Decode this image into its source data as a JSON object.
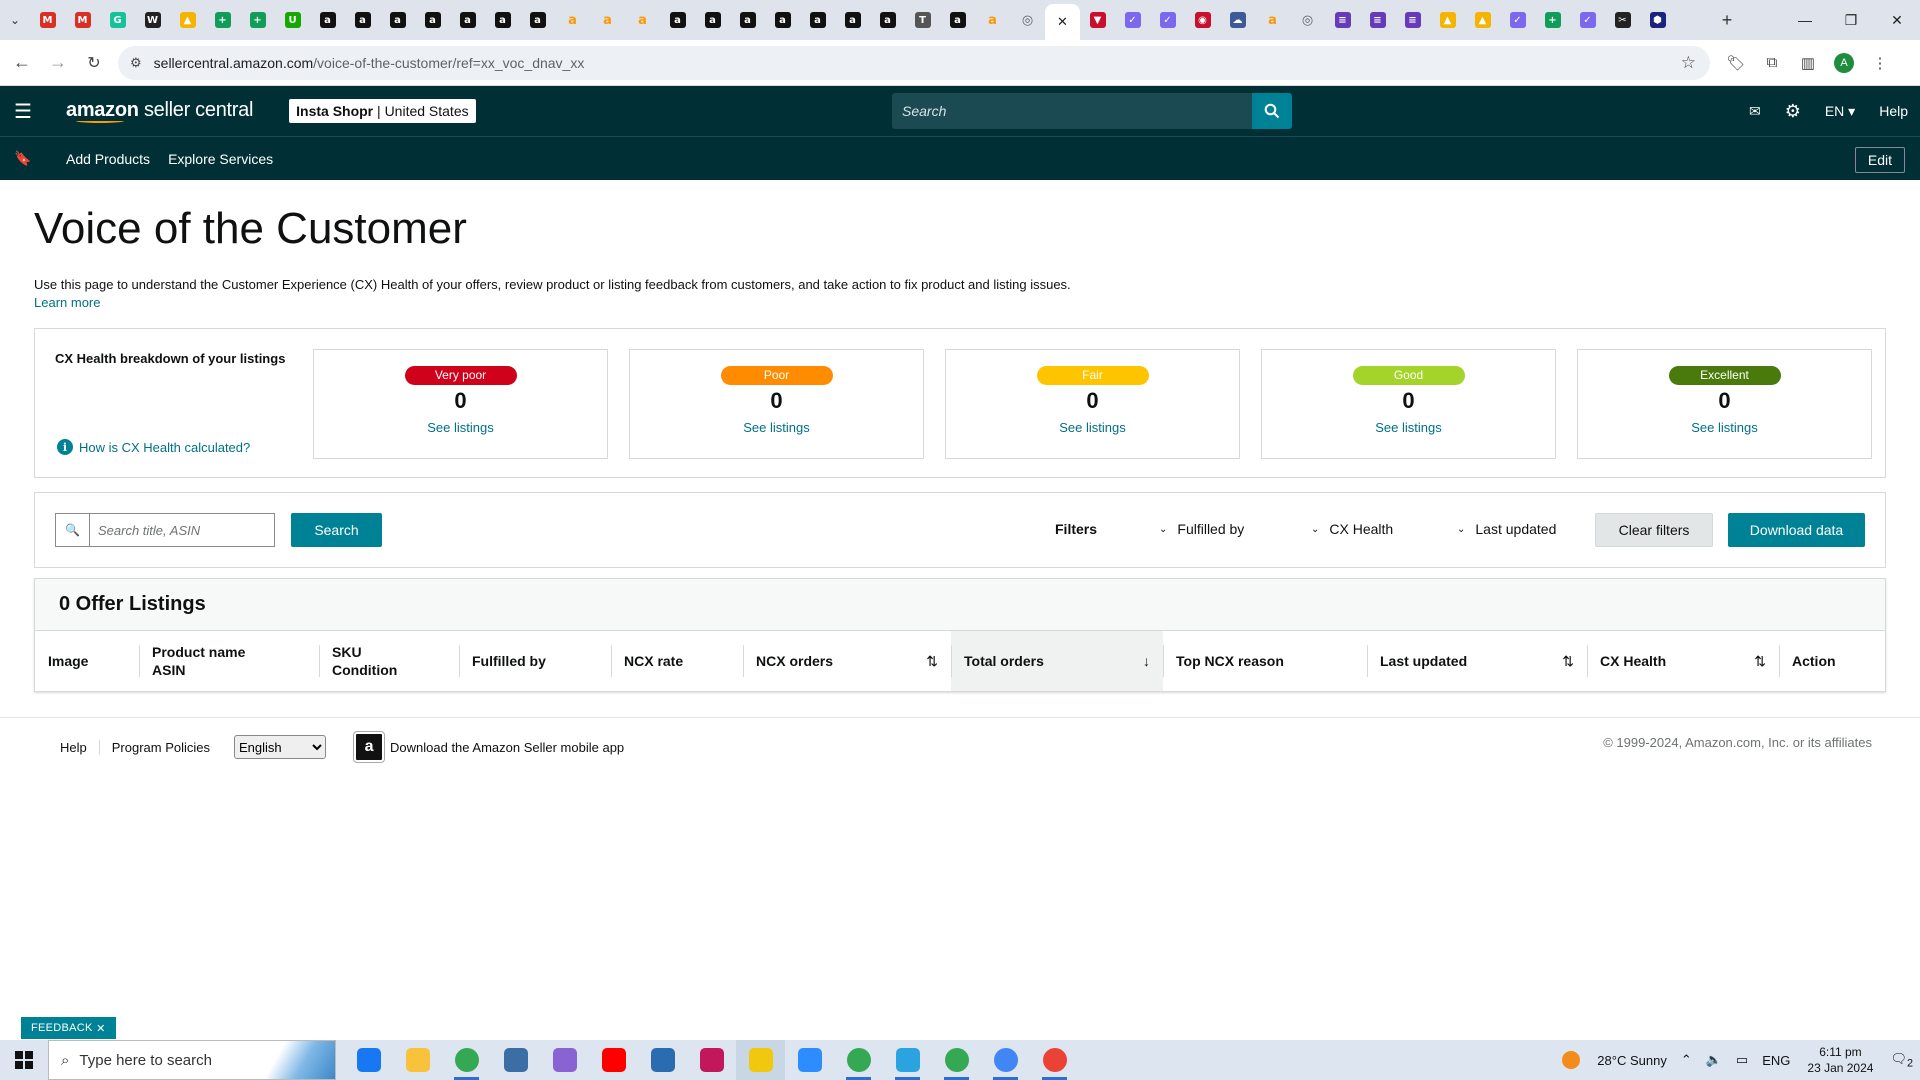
{
  "browser": {
    "url_host": "sellercentral.amazon.com",
    "url_path": "/voice-of-the-customer/ref=xx_voc_dnav_xx",
    "tab_favicons": [
      {
        "icon": "gmail-icon",
        "color": "#d93025",
        "glyph": "M"
      },
      {
        "icon": "gmail-icon",
        "color": "#d93025",
        "glyph": "M"
      },
      {
        "icon": "grammarly-icon",
        "color": "#15c39a",
        "glyph": "G"
      },
      {
        "icon": "wix-icon",
        "color": "#222222",
        "glyph": "W"
      },
      {
        "icon": "drive-icon",
        "color": "#f4b400",
        "glyph": "▲"
      },
      {
        "icon": "sheets-icon",
        "color": "#0f9d58",
        "glyph": "+"
      },
      {
        "icon": "sheets-icon",
        "color": "#0f9d58",
        "glyph": "+"
      },
      {
        "icon": "upwork-icon",
        "color": "#14a800",
        "glyph": "U"
      },
      {
        "icon": "amazon-icon",
        "color": "#111111",
        "glyph": "a"
      },
      {
        "icon": "amazon-icon",
        "color": "#111111",
        "glyph": "a"
      },
      {
        "icon": "amazon-icon",
        "color": "#111111",
        "glyph": "a"
      },
      {
        "icon": "amazon-icon",
        "color": "#111111",
        "glyph": "a"
      },
      {
        "icon": "amazon-icon",
        "color": "#111111",
        "glyph": "a"
      },
      {
        "icon": "amazon-icon",
        "color": "#111111",
        "glyph": "a"
      },
      {
        "icon": "amazon-icon",
        "color": "#111111",
        "glyph": "a"
      },
      {
        "icon": "amazon-smile-icon",
        "color": "#ff9900",
        "glyph": "a"
      },
      {
        "icon": "amazon-smile-icon",
        "color": "#ff9900",
        "glyph": "a"
      },
      {
        "icon": "amazon-smile-icon",
        "color": "#ff9900",
        "glyph": "a"
      },
      {
        "icon": "amazon-icon",
        "color": "#111111",
        "glyph": "a"
      },
      {
        "icon": "amazon-icon",
        "color": "#111111",
        "glyph": "a"
      },
      {
        "icon": "amazon-icon",
        "color": "#111111",
        "glyph": "a"
      },
      {
        "icon": "amazon-icon",
        "color": "#111111",
        "glyph": "a"
      },
      {
        "icon": "amazon-icon",
        "color": "#111111",
        "glyph": "a"
      },
      {
        "icon": "amazon-icon",
        "color": "#111111",
        "glyph": "a"
      },
      {
        "icon": "amazon-icon",
        "color": "#111111",
        "glyph": "a"
      },
      {
        "icon": "helium-icon",
        "color": "#555555",
        "glyph": "T"
      },
      {
        "icon": "amazon-icon",
        "color": "#111111",
        "glyph": "a"
      },
      {
        "icon": "amazon-smile-icon",
        "color": "#ff9900",
        "glyph": "a"
      },
      {
        "icon": "globe-icon",
        "color": "#5f6368",
        "glyph": "◎"
      },
      {
        "icon": "close-icon",
        "color": "#202124",
        "glyph": "✕"
      },
      {
        "icon": "pin-icon",
        "color": "#c8102e",
        "glyph": "▼"
      },
      {
        "icon": "clickup-icon",
        "color": "#7b68ee",
        "glyph": "✓"
      },
      {
        "icon": "clickup-icon",
        "color": "#7b68ee",
        "glyph": "✓"
      },
      {
        "icon": "media-icon",
        "color": "#c8102e",
        "glyph": "◉"
      },
      {
        "icon": "cloud-icon",
        "color": "#3d5a99",
        "glyph": "☁"
      },
      {
        "icon": "amazon-smile-icon",
        "color": "#ff9900",
        "glyph": "a"
      },
      {
        "icon": "globe-icon",
        "color": "#5f6368",
        "glyph": "◎"
      },
      {
        "icon": "forms-icon",
        "color": "#673ab7",
        "glyph": "≡"
      },
      {
        "icon": "forms-icon",
        "color": "#673ab7",
        "glyph": "≡"
      },
      {
        "icon": "forms-icon",
        "color": "#673ab7",
        "glyph": "≡"
      },
      {
        "icon": "drive-icon",
        "color": "#f4b400",
        "glyph": "▲"
      },
      {
        "icon": "drive-icon",
        "color": "#f4b400",
        "glyph": "▲"
      },
      {
        "icon": "clickup-icon",
        "color": "#7b68ee",
        "glyph": "✓"
      },
      {
        "icon": "sheets-icon",
        "color": "#0f9d58",
        "glyph": "+"
      },
      {
        "icon": "clickup-icon",
        "color": "#7b68ee",
        "glyph": "✓"
      },
      {
        "icon": "scissor-icon",
        "color": "#222222",
        "glyph": "✂"
      },
      {
        "icon": "hexagon-icon",
        "color": "#1a237e",
        "glyph": "⬢"
      }
    ],
    "profile_initial": "A"
  },
  "header": {
    "logo_brand": "amazon",
    "logo_suffix": "seller central",
    "account_store": "Insta Shopr",
    "account_region": "United States",
    "search_placeholder": "Search",
    "language": "EN",
    "help": "Help"
  },
  "subnav": {
    "add_products": "Add Products",
    "explore_services": "Explore Services",
    "edit": "Edit"
  },
  "page": {
    "title": "Voice of the Customer",
    "description": "Use this page to understand the Customer Experience (CX) Health of your offers, review product or listing feedback from customers, and take action to fix product and listing issues.",
    "learn_more": "Learn more"
  },
  "cx_health": {
    "title": "CX Health breakdown of your listings",
    "how_link": "How is CX Health calculated?",
    "cards": [
      {
        "label": "Very poor",
        "count": "0",
        "link": "See listings",
        "color": "#d0021b",
        "text_color": "#ffffff"
      },
      {
        "label": "Poor",
        "count": "0",
        "link": "See listings",
        "color": "#ff8c00",
        "text_color": "#ffffff"
      },
      {
        "label": "Fair",
        "count": "0",
        "link": "See listings",
        "color": "#ffc400",
        "text_color": "#ffffff"
      },
      {
        "label": "Good",
        "count": "0",
        "link": "See listings",
        "color": "#a4d32a",
        "text_color": "#ffffff"
      },
      {
        "label": "Excellent",
        "count": "0",
        "link": "See listings",
        "color": "#4a7a0c",
        "text_color": "#ffffff"
      }
    ]
  },
  "filters": {
    "search_placeholder": "Search title, ASIN",
    "search_button": "Search",
    "filters_label": "Filters",
    "fulfilled_by": "Fulfilled by",
    "cx_health": "CX Health",
    "last_updated": "Last updated",
    "clear_filters": "Clear filters",
    "download_data": "Download data"
  },
  "listings": {
    "heading": "0 Offer Listings",
    "columns": [
      {
        "line1": "Image",
        "line2": ""
      },
      {
        "line1": "Product name",
        "line2": "ASIN"
      },
      {
        "line1": "SKU",
        "line2": "Condition"
      },
      {
        "line1": "Fulfilled by",
        "line2": ""
      },
      {
        "line1": "NCX rate",
        "line2": ""
      },
      {
        "line1": "NCX orders",
        "line2": ""
      },
      {
        "line1": "Total orders",
        "line2": ""
      },
      {
        "line1": "Top NCX reason",
        "line2": ""
      },
      {
        "line1": "Last updated",
        "line2": ""
      },
      {
        "line1": "CX Health",
        "line2": ""
      },
      {
        "line1": "Action",
        "line2": ""
      }
    ]
  },
  "footer": {
    "help": "Help",
    "program_policies": "Program Policies",
    "language_selected": "English",
    "download_app": "Download the Amazon Seller mobile app",
    "copyright": "© 1999-2024, Amazon.com, Inc. or its affiliates"
  },
  "feedback": "FEEDBACK",
  "taskbar": {
    "search_placeholder": "Type here to search",
    "apps": [
      {
        "icon": "facebook-icon",
        "color": "#1877f2"
      },
      {
        "icon": "file-explorer-icon",
        "color": "#f8c33a"
      },
      {
        "icon": "chrome-icon",
        "color": "#34a853"
      },
      {
        "icon": "calculator-icon",
        "color": "#3a6ea5"
      },
      {
        "icon": "copilot-icon",
        "color": "#8a63d2"
      },
      {
        "icon": "youtube-icon",
        "color": "#ff0000"
      },
      {
        "icon": "store-icon",
        "color": "#2b6cb0"
      },
      {
        "icon": "snipping-tool-icon",
        "color": "#c2185b"
      },
      {
        "icon": "sticky-notes-icon",
        "color": "#f2c80f"
      },
      {
        "icon": "zoom-icon",
        "color": "#2d8cff"
      },
      {
        "icon": "chrome-icon",
        "color": "#34a853"
      },
      {
        "icon": "telegram-icon",
        "color": "#2aa3e0"
      },
      {
        "icon": "chrome-icon",
        "color": "#34a853"
      },
      {
        "icon": "chrome-icon",
        "color": "#4285f4"
      },
      {
        "icon": "chrome-icon",
        "color": "#ea4335"
      }
    ],
    "weather": "28°C  Sunny",
    "language": "ENG",
    "time": "6:11 pm",
    "date": "23 Jan 2024",
    "notifications": "2"
  }
}
